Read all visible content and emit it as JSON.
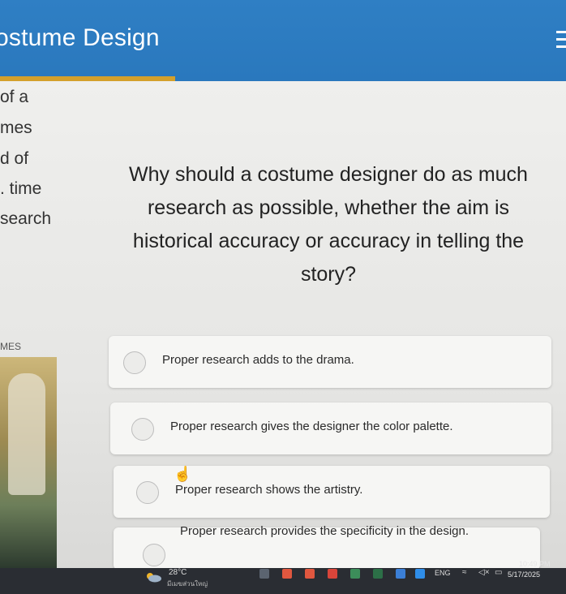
{
  "header": {
    "title": "ostume Design",
    "menu_icon": "hamburger-menu-icon"
  },
  "progress": {
    "fraction": 0.31,
    "color": "#d4a02b"
  },
  "left_panel": {
    "fragments": [
      "of a",
      "mes",
      "d  of",
      ". time",
      "search"
    ]
  },
  "question": {
    "text": "Why should a costume designer do as much research as possible, whether the aim is historical accuracy or accuracy in telling the story?"
  },
  "section_label": "MES",
  "answers": [
    {
      "label": "Proper research adds to the drama."
    },
    {
      "label": "Proper research gives the designer the color palette."
    },
    {
      "label": "Proper research shows the artistry."
    },
    {
      "label": "Proper research provides the specificity in the design."
    }
  ],
  "taskbar": {
    "temperature": "28°C",
    "condition": "มีเมฆส่วนใหญ่",
    "language": "ENG",
    "time": "10:49 PM",
    "date": "5/17/2025"
  },
  "colors": {
    "header": "#2f7fc4",
    "accent": "#d4a02b",
    "taskbar": "#2a2d33"
  }
}
